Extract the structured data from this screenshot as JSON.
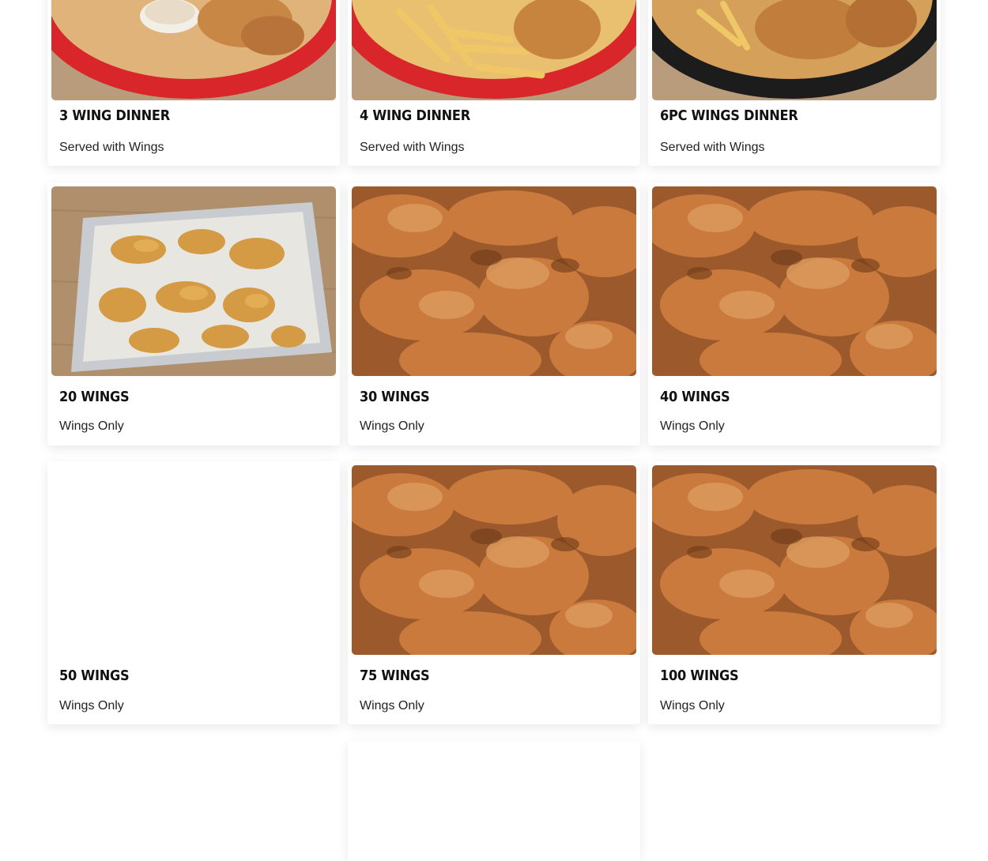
{
  "menu_items": [
    {
      "title": "3 WING DINNER",
      "description": "Served with Wings",
      "image": "wings-fries-red-basket"
    },
    {
      "title": "4 WING DINNER",
      "description": "Served with Wings",
      "image": "wings-fries-red-basket"
    },
    {
      "title": "6PC WINGS DINNER",
      "description": "Served with Wings",
      "image": "wings-fries-black-basket"
    },
    {
      "title": "20 WINGS",
      "description": "Wings Only",
      "image": "wings-foil-tray"
    },
    {
      "title": "30 WINGS",
      "description": "Wings Only",
      "image": "fried-wings-closeup"
    },
    {
      "title": "40 WINGS",
      "description": "Wings Only",
      "image": "fried-wings-closeup"
    },
    {
      "title": "50 WINGS",
      "description": "Wings Only",
      "image": ""
    },
    {
      "title": "75 WINGS",
      "description": "Wings Only",
      "image": "fried-wings-closeup"
    },
    {
      "title": "100 WINGS",
      "description": "Wings Only",
      "image": "fried-wings-closeup"
    }
  ],
  "colors": {
    "title": "#111111",
    "description": "#222222",
    "basket_red": "#d8262b",
    "fried_golden": "#c97a3c"
  }
}
